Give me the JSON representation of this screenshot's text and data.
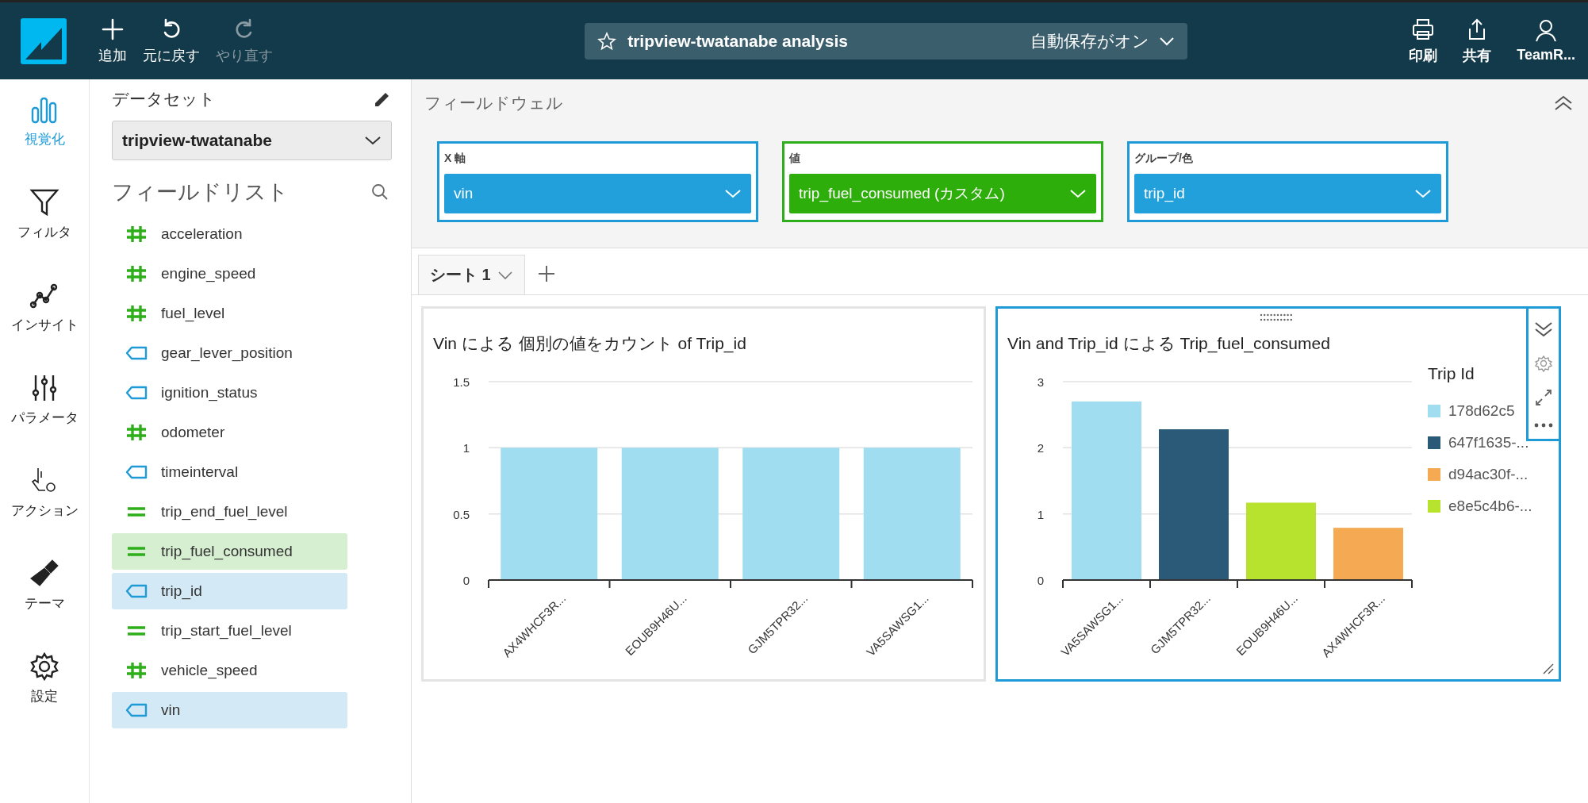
{
  "topbar": {
    "actions": [
      {
        "label": "追加",
        "disabled": false
      },
      {
        "label": "元に戻す",
        "disabled": false
      },
      {
        "label": "やり直す",
        "disabled": true
      }
    ],
    "title": "tripview-twatanabe analysis",
    "autosave": "自動保存がオン",
    "right_actions": [
      {
        "label": "印刷"
      },
      {
        "label": "共有"
      },
      {
        "label": "TeamR..."
      }
    ]
  },
  "nav": [
    {
      "label": "視覚化",
      "selected": true
    },
    {
      "label": "フィルタ",
      "selected": false
    },
    {
      "label": "インサイト",
      "selected": false
    },
    {
      "label": "パラメータ",
      "selected": false
    },
    {
      "label": "アクション",
      "selected": false
    },
    {
      "label": "テーマ",
      "selected": false
    },
    {
      "label": "設定",
      "selected": false
    }
  ],
  "dataset": {
    "heading": "データセット",
    "value": "tripview-twatanabe"
  },
  "field_list": {
    "heading": "フィールドリスト",
    "items": [
      {
        "name": "acceleration",
        "kind": "measure",
        "selected": false
      },
      {
        "name": "engine_speed",
        "kind": "measure",
        "selected": false
      },
      {
        "name": "fuel_level",
        "kind": "measure",
        "selected": false
      },
      {
        "name": "gear_lever_position",
        "kind": "dimension",
        "selected": false
      },
      {
        "name": "ignition_status",
        "kind": "dimension",
        "selected": false
      },
      {
        "name": "odometer",
        "kind": "measure",
        "selected": false
      },
      {
        "name": "timeinterval",
        "kind": "dimension",
        "selected": false
      },
      {
        "name": "trip_end_fuel_level",
        "kind": "calculated",
        "selected": false
      },
      {
        "name": "trip_fuel_consumed",
        "kind": "calculated",
        "selected": true
      },
      {
        "name": "trip_id",
        "kind": "dimension",
        "selected": true
      },
      {
        "name": "trip_start_fuel_level",
        "kind": "calculated",
        "selected": false
      },
      {
        "name": "vehicle_speed",
        "kind": "measure",
        "selected": false
      },
      {
        "name": "vin",
        "kind": "dimension",
        "selected": true
      }
    ]
  },
  "field_wells": {
    "heading": "フィールドウェル",
    "wells": [
      {
        "label": "X 軸",
        "value": "vin",
        "kind": "dimension"
      },
      {
        "label": "値",
        "value": "trip_fuel_consumed (カスタム)",
        "kind": "measure"
      },
      {
        "label": "グループ/色",
        "value": "trip_id",
        "kind": "dimension"
      }
    ]
  },
  "sheet_tabs": [
    {
      "label": "シート 1",
      "selected": true
    }
  ],
  "visuals": [
    {
      "title": "Vin による 個別の値をカウント of Trip_id",
      "selected": false,
      "chart_data": {
        "type": "bar",
        "categories": [
          "AX4WHCF3R...",
          "EOUB9H46U...",
          "GJM5TPR32...",
          "VA5SAWSG1..."
        ],
        "values": [
          1,
          1,
          1,
          1
        ],
        "color": "#a0ddf0",
        "ylim": [
          0,
          1.5
        ],
        "yticks": [
          0,
          0.5,
          1,
          1.5
        ]
      }
    },
    {
      "title": "Vin and Trip_id による Trip_fuel_consumed",
      "selected": true,
      "legend_title": "Trip Id",
      "chart_data": {
        "type": "bar",
        "stacked": true,
        "categories": [
          "VA5SAWSG1...",
          "GJM5TPR32...",
          "EOUB9H46U...",
          "AX4WHCF3R..."
        ],
        "series": [
          {
            "name": "178d62c5",
            "color": "#a0ddf0",
            "values": [
              2.7,
              null,
              null,
              null
            ]
          },
          {
            "name": "647f1635-...",
            "color": "#2a5a78",
            "values": [
              null,
              2.28,
              null,
              null
            ]
          },
          {
            "name": "d94ac30f-...",
            "color": "#f5a953",
            "values": [
              null,
              null,
              null,
              0.79
            ]
          },
          {
            "name": "e8e5c4b6-...",
            "color": "#b7e22e",
            "values": [
              null,
              null,
              1.17,
              null
            ]
          }
        ],
        "ylim": [
          0,
          3
        ],
        "yticks": [
          0,
          1,
          2,
          3
        ]
      }
    }
  ]
}
